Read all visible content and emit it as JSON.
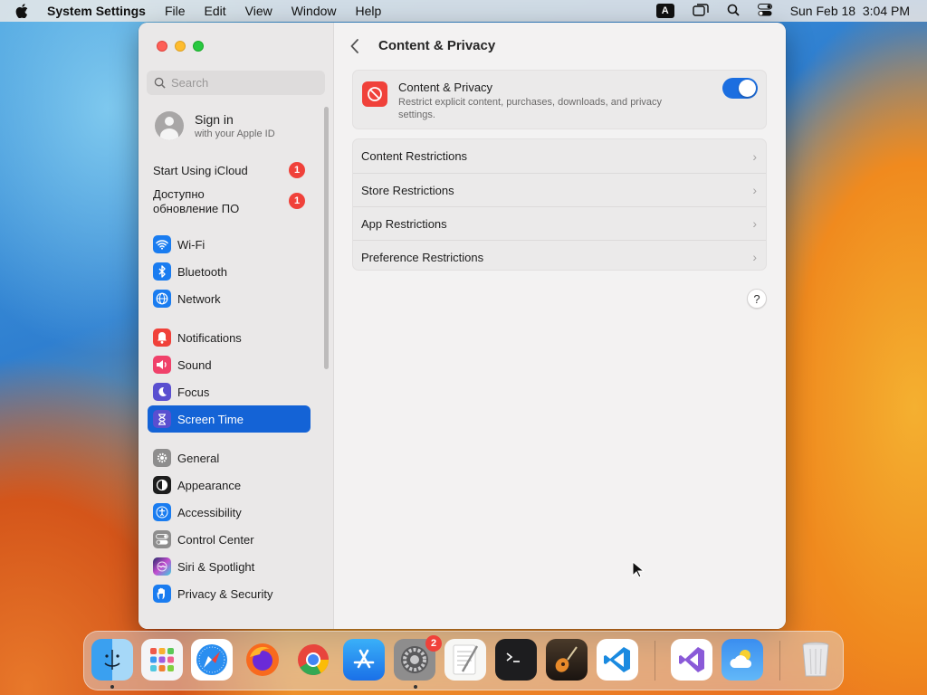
{
  "menubar": {
    "app_name": "System Settings",
    "items": [
      "File",
      "Edit",
      "View",
      "Window",
      "Help"
    ],
    "input_source": "A",
    "datetime": "Sun Feb 18  3:04 PM"
  },
  "sidebar": {
    "search_placeholder": "Search",
    "signin": {
      "title": "Sign in",
      "subtitle": "with your Apple ID"
    },
    "notices": [
      {
        "label": "Start Using iCloud",
        "badge": "1"
      },
      {
        "label": "Доступно обновление ПО",
        "badge": "1"
      }
    ],
    "items": [
      {
        "label": "Wi-Fi",
        "icon": "wifi-icon",
        "color": "#1a7cf0"
      },
      {
        "label": "Bluetooth",
        "icon": "bluetooth-icon",
        "color": "#1a7cf0"
      },
      {
        "label": "Network",
        "icon": "globe-icon",
        "color": "#1a7cf0"
      },
      {
        "label": "Notifications",
        "icon": "bell-icon",
        "color": "#f0413a"
      },
      {
        "label": "Sound",
        "icon": "speaker-icon",
        "color": "#f0416a"
      },
      {
        "label": "Focus",
        "icon": "moon-icon",
        "color": "#5a4fd0"
      },
      {
        "label": "Screen Time",
        "icon": "hourglass-icon",
        "color": "#5a4fd0"
      },
      {
        "label": "General",
        "icon": "gear-icon",
        "color": "#8e8d8d"
      },
      {
        "label": "Appearance",
        "icon": "appearance-icon",
        "color": "#1d1d1d"
      },
      {
        "label": "Accessibility",
        "icon": "accessibility-icon",
        "color": "#1a7cf0"
      },
      {
        "label": "Control Center",
        "icon": "control-center-icon",
        "color": "#8e8d8d"
      },
      {
        "label": "Siri & Spotlight",
        "icon": "siri-icon",
        "color": "#c24fd0"
      },
      {
        "label": "Privacy & Security",
        "icon": "hand-icon",
        "color": "#1a7cf0"
      }
    ],
    "active_item": "Screen Time"
  },
  "main": {
    "title": "Content & Privacy",
    "toggle_card": {
      "title": "Content & Privacy",
      "description": "Restrict explicit content, purchases, downloads, and privacy settings.",
      "enabled": true
    },
    "rows": [
      "Content Restrictions",
      "Store Restrictions",
      "App Restrictions",
      "Preference Restrictions"
    ],
    "help_label": "?"
  },
  "dock": {
    "apps": [
      "Finder",
      "Launchpad",
      "Safari",
      "Firefox",
      "Chrome",
      "App Store",
      "System Settings",
      "TextEdit",
      "Terminal",
      "GarageBand",
      "Visual Studio Code",
      "Visual Studio",
      "Weather",
      "Trash"
    ],
    "system_settings_badge": "2"
  },
  "colors": {
    "accent": "#1463d6",
    "badge": "#f0413a",
    "toggle_on": "#1b6ee0"
  }
}
